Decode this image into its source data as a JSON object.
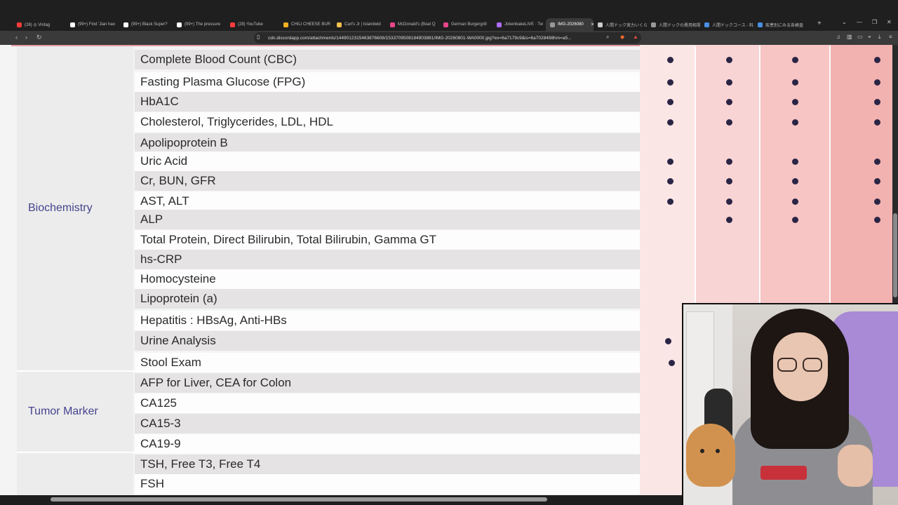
{
  "browser": {
    "tabs": [
      {
        "label": "(28) ◎ Vintag",
        "icon": "youtube-icon",
        "color": "#ff3b3b"
      },
      {
        "label": "(99+) Find 'Jian hao",
        "icon": "tiktok-icon",
        "color": "#ffffff"
      },
      {
        "label": "(99+) Black Super?",
        "icon": "tiktok-icon",
        "color": "#ffffff"
      },
      {
        "label": "(99+) The pressure",
        "icon": "tiktok-icon",
        "color": "#ffffff"
      },
      {
        "label": "(28) YouTube",
        "icon": "youtube-icon",
        "color": "#ff3b3b"
      },
      {
        "label": "CHILI CHEESE BUR",
        "icon": "star-icon",
        "color": "#f0b020"
      },
      {
        "label": "Carl's Jr | Islandwid",
        "icon": "doc-icon",
        "color": "#f2c14e"
      },
      {
        "label": "McDonald's (Boat Q",
        "icon": "doc-icon",
        "color": "#e8458b"
      },
      {
        "label": "German Burgergrill",
        "icon": "doc-icon",
        "color": "#e8458b"
      },
      {
        "label": "JokenbakeLIVE · Tw",
        "icon": "twitch-icon",
        "color": "#b06cff"
      },
      {
        "label": "IMG-2026080",
        "icon": "globe-icon",
        "color": "#999999"
      },
      {
        "label": "人間ドック実力いくら",
        "icon": "globe-icon",
        "color": "#cccccc"
      },
      {
        "label": "人間ドックの費用相場",
        "icon": "globe-icon",
        "color": "#999999"
      },
      {
        "label": "人間ドックコース - 料金",
        "icon": "doc-icon",
        "color": "#4a90e2"
      },
      {
        "label": "疾患別にみる各検査",
        "icon": "doc-icon",
        "color": "#4a90e2"
      }
    ],
    "url": "cdn.discordapp.com/attachments/1449012315463876608/1533709508184903881/IMG-20260801-WA0000.jpg?ex=6a7179c9&is=6a7028498hm=a5..."
  },
  "categories": [
    {
      "label": "Biochemistry"
    },
    {
      "label": "Tumor Marker"
    },
    {
      "label": ""
    }
  ],
  "rows": [
    {
      "label": "Complete Blood Count (CBC)",
      "marks": [
        1,
        1,
        1,
        1
      ]
    },
    {
      "label": "Fasting Plasma Glucose (FPG)",
      "marks": [
        1,
        1,
        1,
        1
      ]
    },
    {
      "label": "HbA1C",
      "marks": [
        1,
        1,
        1,
        1
      ]
    },
    {
      "label": "Cholesterol, Triglycerides, LDL, HDL",
      "marks": [
        1,
        1,
        1,
        1
      ]
    },
    {
      "label": "Apolipoprotein B",
      "marks": [
        0,
        0,
        0,
        0
      ]
    },
    {
      "label": "Uric Acid",
      "marks": [
        1,
        1,
        1,
        1
      ]
    },
    {
      "label": "Cr, BUN, GFR",
      "marks": [
        1,
        1,
        1,
        1
      ]
    },
    {
      "label": "AST, ALT",
      "marks": [
        1,
        1,
        1,
        1
      ]
    },
    {
      "label": "ALP",
      "marks": [
        0,
        1,
        1,
        1
      ]
    },
    {
      "label": "Total Protein, Direct Bilirubin, Total Bilirubin, Gamma GT",
      "marks": [
        0,
        0,
        0,
        0
      ]
    },
    {
      "label": "hs-CRP",
      "marks": [
        0,
        0,
        0,
        0
      ]
    },
    {
      "label": "Homocysteine",
      "marks": [
        0,
        0,
        0,
        0
      ]
    },
    {
      "label": "Lipoprotein (a)",
      "marks": [
        0,
        0,
        0,
        0
      ]
    },
    {
      "label": "Hepatitis : HBsAg, Anti-HBs",
      "marks": [
        0,
        0,
        0,
        0
      ]
    },
    {
      "label": "Urine Analysis",
      "marks": [
        1,
        0,
        0,
        0
      ]
    },
    {
      "label": "Stool Exam",
      "marks": [
        1,
        0,
        0,
        0
      ]
    },
    {
      "label": "AFP for Liver,   CEA for Colon",
      "marks": [
        0,
        0,
        0,
        0
      ]
    },
    {
      "label": "CA125",
      "marks": [
        0,
        0,
        0,
        0
      ]
    },
    {
      "label": "CA15-3",
      "marks": [
        0,
        0,
        0,
        0
      ]
    },
    {
      "label": "CA19-9",
      "marks": [
        0,
        0,
        0,
        0
      ]
    },
    {
      "label": "TSH, Free T3, Free T4",
      "marks": [
        0,
        0,
        0,
        0
      ]
    },
    {
      "label": "FSH",
      "marks": [
        0,
        0,
        0,
        0
      ]
    }
  ],
  "colors": {
    "dot": "#2b2545",
    "category_text": "#46438d",
    "package_columns": [
      "#fbe6e6",
      "#f9d4d4",
      "#f6c5c4",
      "#f2b2b0"
    ]
  }
}
